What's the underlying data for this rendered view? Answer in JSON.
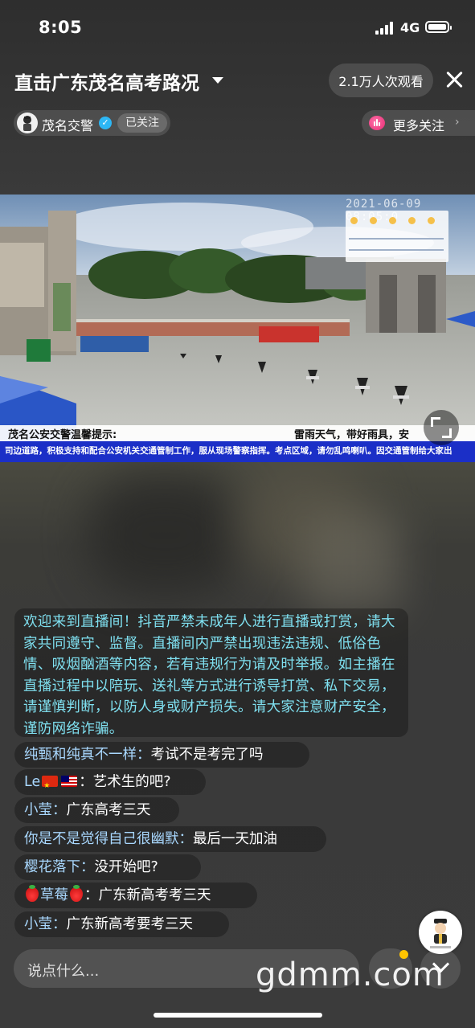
{
  "status_bar": {
    "time": "8:05",
    "network": "4G"
  },
  "header": {
    "title": "直击广东茂名高考路况",
    "viewers": "2.1万人次观看"
  },
  "host": {
    "name": "茂名交警",
    "follow_state": "已关注",
    "more_follow": "更多关注"
  },
  "video": {
    "timestamp": "2021-06-09  08:05:0",
    "notice_title": "茂名公安交警温馨提示:",
    "notice_weather": "雷雨天气，带好雨具，安",
    "ticker": "司边道路，积极支持和配合公安机关交通管制工作，服从现场警察指挥。考点区域，请勿乱鸣喇叭。因交通管制给大家出"
  },
  "chat": {
    "welcome": "欢迎来到直播间！抖音严禁未成年人进行直播或打赏，请大家共同遵守、监督。直播间内严禁出现违法违规、低俗色情、吸烟酗酒等内容，若有违规行为请及时举报。如主播在直播过程中以陪玩、送礼等方式进行诱导打赏、私下交易，请谨慎判断，以防人身或财产损失。请大家注意财产安全，谨防网络诈骗。",
    "messages": [
      {
        "user": "纯甄和纯真不一样：",
        "text": "考试不是考完了吗"
      },
      {
        "user": "Le",
        "text": "：艺术生的吧?"
      },
      {
        "user": "小莹：",
        "text": "广东高考三天"
      },
      {
        "user": "你是不是觉得自己很幽默：",
        "text": "最后一天加油"
      },
      {
        "user": "樱花落下：",
        "text": "没开始吧?"
      },
      {
        "user": "草莓",
        "text": "：广东新高考考三天"
      },
      {
        "user": "小莹：",
        "text": "广东新高考要考三天"
      }
    ]
  },
  "input": {
    "placeholder": "说点什么..."
  },
  "watermark": "gdmm.com",
  "colors": {
    "chat_system": "#7fe0f0",
    "chat_user": "#a9d8ff",
    "ticker_bg": "#1b2fc7",
    "verified": "#2db7f5",
    "notify_dot": "#ffc400"
  }
}
